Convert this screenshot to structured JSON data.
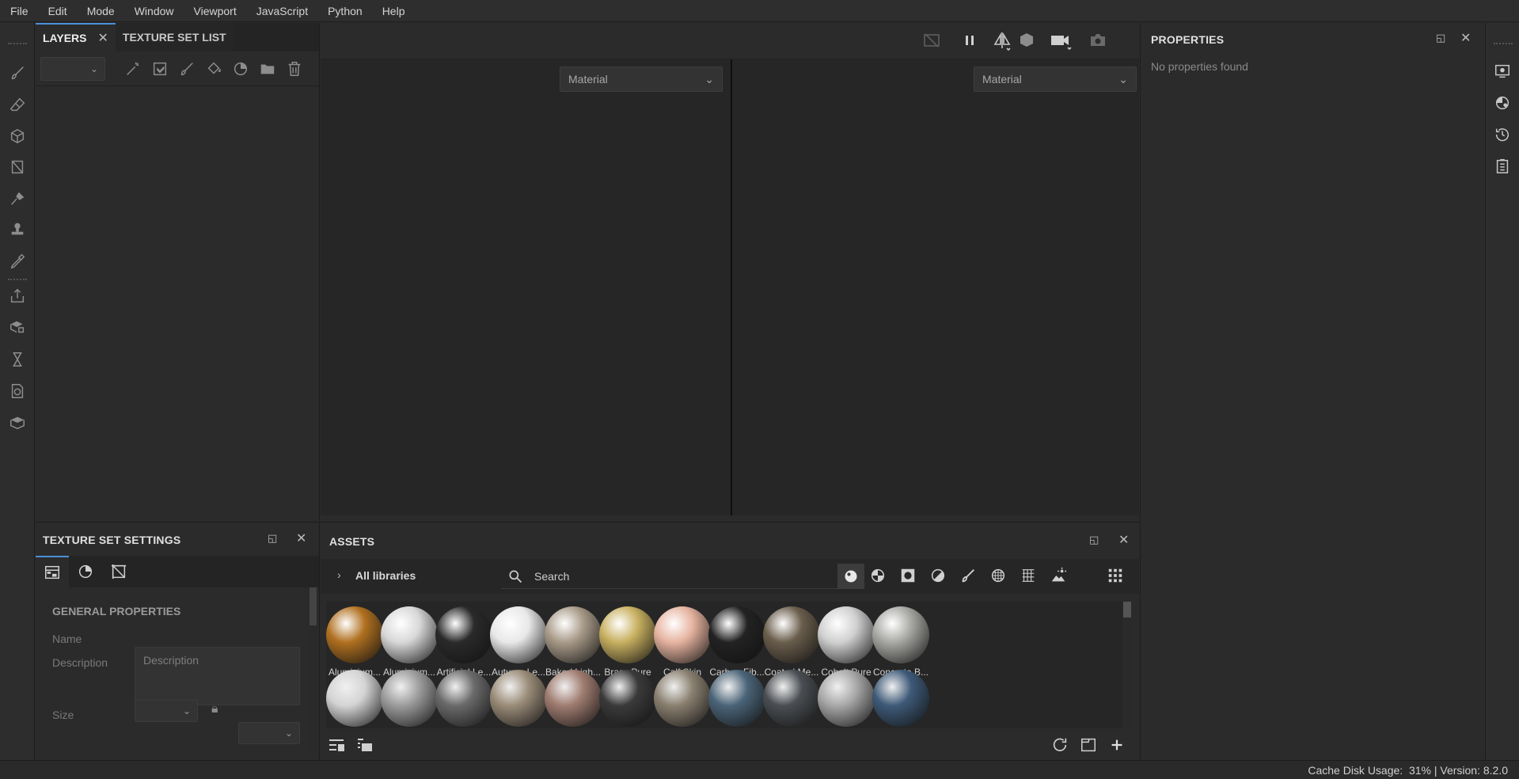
{
  "menu": [
    "File",
    "Edit",
    "Mode",
    "Window",
    "Viewport",
    "JavaScript",
    "Python",
    "Help"
  ],
  "layers": {
    "tab_layers": "LAYERS",
    "tab_texture_set_list": "TEXTURE SET LIST"
  },
  "viewport": {
    "left_select": "Material",
    "right_select": "Material"
  },
  "properties": {
    "title": "PROPERTIES",
    "empty_text": "No properties found"
  },
  "texture_set_settings": {
    "title": "TEXTURE SET SETTINGS",
    "section": "GENERAL PROPERTIES",
    "name_label": "Name",
    "description_label": "Description",
    "description_placeholder": "Description",
    "size_label": "Size"
  },
  "assets": {
    "title": "ASSETS",
    "library": "All libraries",
    "search_placeholder": "Search",
    "row1": [
      {
        "label": "Aluminium...",
        "color": "#b07020"
      },
      {
        "label": "Aluminium...",
        "color": "#d8d8d8"
      },
      {
        "label": "Artificial Le...",
        "color": "#2a2a2a"
      },
      {
        "label": "Autumn Le...",
        "color": "#e8e8e8"
      },
      {
        "label": "Baked Ligh...",
        "color": "#a89a88"
      },
      {
        "label": "Brass Pure",
        "color": "#c8b060"
      },
      {
        "label": "Calf Skin",
        "color": "#e6b4a0"
      },
      {
        "label": "Carbon Fib...",
        "color": "#222222"
      },
      {
        "label": "Coated Me...",
        "color": "#6a5e4c"
      },
      {
        "label": "Cobalt Pure",
        "color": "#d0d0d0"
      },
      {
        "label": "Concrete B...",
        "color": "#a8a8a4"
      }
    ],
    "row2_colors": [
      "#d4d4d4",
      "#9c9c9c",
      "#6a6a6a",
      "#9a8c78",
      "#a07c70",
      "#3a3a3a",
      "#8a8070",
      "#4a6478",
      "#4a4e52",
      "#a8a8a8",
      "#3e5a78"
    ]
  },
  "status": {
    "text": "Cache Disk Usage:  31% | Version: 8.2.0"
  },
  "colors": {
    "accent": "#4a90d9",
    "panel_bg": "#2b2b2b",
    "viewport_bg": "#262626"
  }
}
